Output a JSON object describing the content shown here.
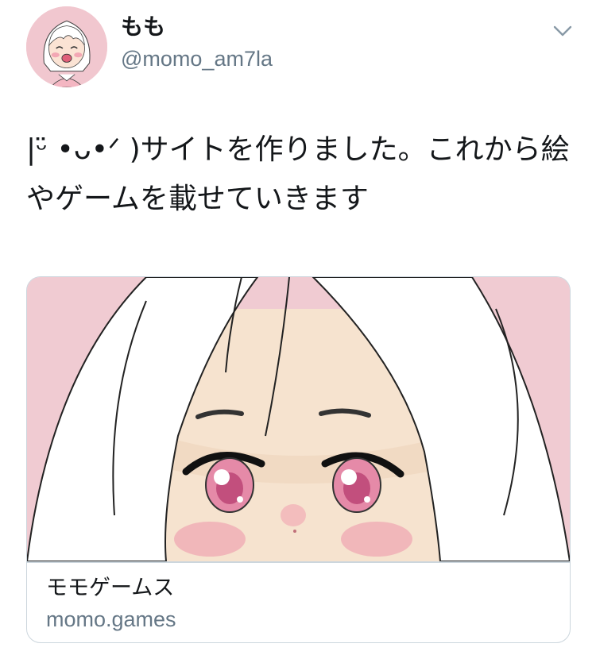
{
  "tweet": {
    "author_name": "もも",
    "author_handle": "@momo_am7la",
    "text": "|ʚ̴̶̷̷·̫ )サイトを作りました。これから絵やゲームを載せていきます",
    "text_display": "|ᵕ̈ •ᴗ•ᐟ )サイトを作りました。これから絵やゲームを載せていきます"
  },
  "card": {
    "title": "モモゲームス",
    "domain": "momo.games"
  },
  "icons": {
    "menu": "chevron-down-icon",
    "avatar": "avatar-image"
  },
  "colors": {
    "secondary_text": "#657786",
    "border": "#ccd6dd",
    "card_bg": "#f0cbd2"
  }
}
